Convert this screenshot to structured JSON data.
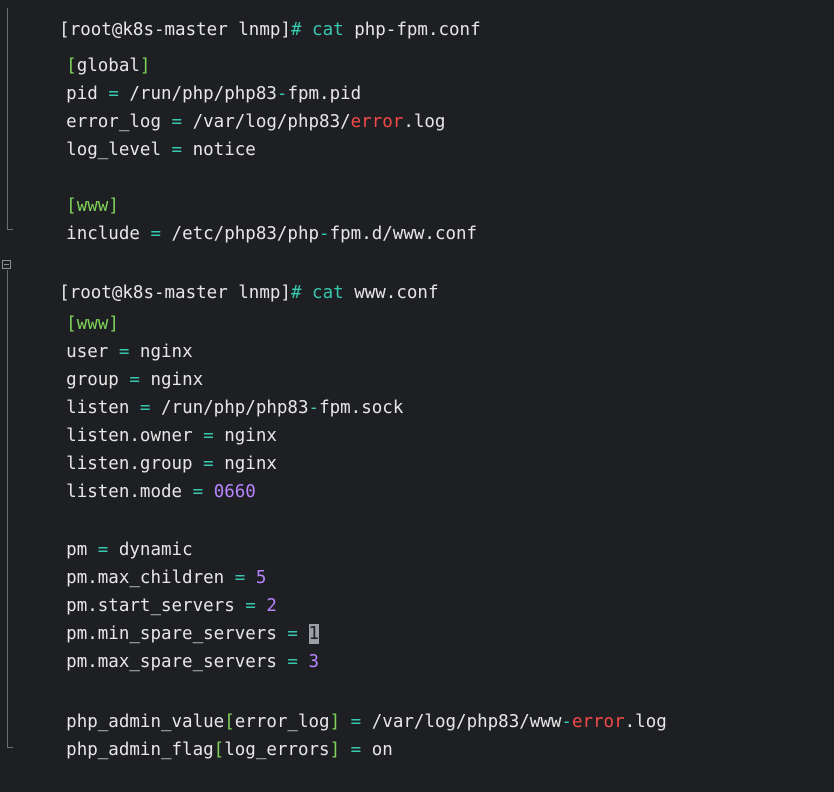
{
  "terminal": {
    "blocks": [
      {
        "prompt_user": "[root@k8s-master lnmp]",
        "prompt_symbol": "#",
        "command_cmd": "cat",
        "command_arg": "php-fpm.conf",
        "lines": {
          "l0_a": "[",
          "l0_b": "global",
          "l0_c": "]",
          "l1_a": "pid ",
          "l1_b": "=",
          "l1_c": " /run/php/php83",
          "l1_d": "-",
          "l1_e": "fpm.pid",
          "l2_a": "error_log ",
          "l2_b": "=",
          "l2_c": " /var/log/php83/",
          "l2_d": "error",
          "l2_e": ".log",
          "l3_a": "log_level ",
          "l3_b": "=",
          "l3_c": " notice",
          "l5_a": "[",
          "l5_b": "www",
          "l5_c": "]",
          "l6_a": "include ",
          "l6_b": "=",
          "l6_c": " /etc/php83/php",
          "l6_d": "-",
          "l6_e": "fpm.d/www.conf"
        }
      },
      {
        "prompt_user": "[root@k8s-master lnmp]",
        "prompt_symbol": "#",
        "command_cmd": "cat",
        "command_arg": "www.conf",
        "lines": {
          "l0_a": "[",
          "l0_b": "www",
          "l0_c": "]",
          "l1_a": "user ",
          "l1_b": "=",
          "l1_c": " nginx",
          "l2_a": "group ",
          "l2_b": "=",
          "l2_c": " nginx",
          "l3_a": "listen ",
          "l3_b": "=",
          "l3_c": " /run/php/php83",
          "l3_d": "-",
          "l3_e": "fpm.sock",
          "l4_a": "listen.owner ",
          "l4_b": "=",
          "l4_c": " nginx",
          "l5_a": "listen.group ",
          "l5_b": "=",
          "l5_c": " nginx",
          "l6_a": "listen.mode ",
          "l6_b": "=",
          "l6_c": " ",
          "l6_d": "0660",
          "l8_a": "pm ",
          "l8_b": "=",
          "l8_c": " dynamic",
          "l9_a": "pm.max_children ",
          "l9_b": "=",
          "l9_c": " ",
          "l9_d": "5",
          "l10_a": "pm.start_servers ",
          "l10_b": "=",
          "l10_c": " ",
          "l10_d": "2",
          "l11_a": "pm.min_spare_servers ",
          "l11_b": "=",
          "l11_c": " ",
          "l11_d": "1",
          "l12_a": "pm.max_spare_servers ",
          "l12_b": "=",
          "l12_c": " ",
          "l12_d": "3",
          "l14_a": "php_admin_value",
          "l14_b": "[",
          "l14_c": "error_log",
          "l14_d": "]",
          "l14_e": " ",
          "l14_f": "=",
          "l14_g": " /var/log/php83/www",
          "l14_h": "-",
          "l14_i": "error",
          "l14_j": ".log",
          "l15_a": "php_admin_flag",
          "l15_b": "[",
          "l15_c": "log_errors",
          "l15_d": "]",
          "l15_e": " ",
          "l15_f": "=",
          "l15_g": " on"
        }
      }
    ],
    "colors": {
      "background": "#1e1f22",
      "text": "#e6e6e6",
      "bracket": "#7fd35a",
      "operator": "#38c8b0",
      "error_word": "#f24a47",
      "number": "#b784ff"
    }
  }
}
